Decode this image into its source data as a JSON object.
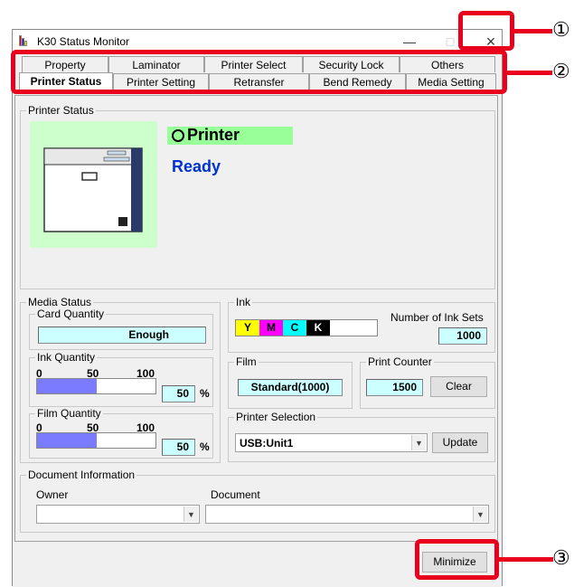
{
  "window": {
    "title": "K30 Status Monitor",
    "minimize_glyph": "—",
    "maximize_glyph": "□",
    "close_glyph": "×"
  },
  "tabs": {
    "row_back": [
      "Property",
      "Laminator",
      "Printer Select",
      "Security Lock",
      "Others"
    ],
    "row_front": [
      "Printer Status",
      "Printer Setting",
      "Retransfer",
      "Bend Remedy",
      "Media Setting"
    ],
    "active": "Printer Status"
  },
  "printer_status": {
    "group_label": "Printer Status",
    "device_label": "Printer",
    "state": "Ready"
  },
  "media_status": {
    "group_label": "Media Status",
    "card_quantity": {
      "label": "Card Quantity",
      "value": "Enough"
    },
    "ink_quantity": {
      "label": "Ink Quantity",
      "scale": [
        "0",
        "50",
        "100"
      ],
      "value": "50",
      "unit": "%",
      "level": 0.5
    },
    "film_quantity": {
      "label": "Film Quantity",
      "scale": [
        "0",
        "50",
        "100"
      ],
      "value": "50",
      "unit": "%",
      "level": 0.5
    }
  },
  "ink": {
    "group_label": "Ink",
    "colors": [
      "Y",
      "M",
      "C",
      "K"
    ],
    "color_hex": [
      "#ffff00",
      "#ff00ff",
      "#00ffff",
      "#000000"
    ],
    "sets_label": "Number of Ink Sets",
    "sets_value": "1000"
  },
  "film": {
    "group_label": "Film",
    "value": "Standard(1000)"
  },
  "print_counter": {
    "group_label": "Print Counter",
    "value": "1500",
    "clear_label": "Clear"
  },
  "printer_selection": {
    "group_label": "Printer Selection",
    "selected": "USB:Unit1",
    "update_label": "Update"
  },
  "document_info": {
    "group_label": "Document Information",
    "owner_label": "Owner",
    "document_label": "Document"
  },
  "footer": {
    "minimize_label": "Minimize"
  },
  "callouts": [
    "①",
    "②",
    "③"
  ],
  "colors": {
    "callout_red": "#e8001c",
    "ready_blue": "#0033cc",
    "readout_bg": "#ccffff",
    "status_green": "#99ff99",
    "bar_fill": "#7b7bff"
  }
}
